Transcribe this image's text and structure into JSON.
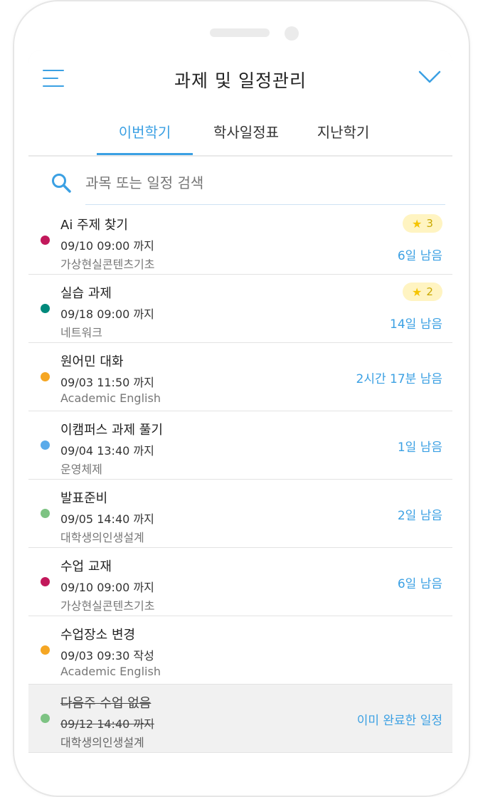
{
  "header": {
    "title": "과제 및 일정관리"
  },
  "tabs": [
    {
      "label": "이번학기"
    },
    {
      "label": "학사일정표"
    },
    {
      "label": "지난학기"
    }
  ],
  "search": {
    "placeholder": "과목 또는 일정 검색"
  },
  "items": [
    {
      "title": "Ai 주제 찾기",
      "due": "09/10 09:00 까지",
      "course": "가상현실콘텐츠기초",
      "color": "#c2185b",
      "stars": "3",
      "remaining": "6일 남음"
    },
    {
      "title": "실습 과제",
      "due": "09/18 09:00 까지",
      "course": "네트워크",
      "color": "#00897b",
      "stars": "2",
      "remaining": "14일 남음"
    },
    {
      "title": "원어민 대화",
      "due": "09/03 11:50 까지",
      "course": "Academic English",
      "color": "#f5a623",
      "stars": null,
      "remaining": "2시간 17분 남음"
    },
    {
      "title": "이캠퍼스 과제 풀기",
      "due": "09/04 13:40 까지",
      "course": "운영체제",
      "color": "#5aabea",
      "stars": null,
      "remaining": "1일 남음"
    },
    {
      "title": "발표준비",
      "due": "09/05 14:40 까지",
      "course": "대학생의인생설계",
      "color": "#7dc383",
      "stars": null,
      "remaining": "2일 남음"
    },
    {
      "title": "수업 교재",
      "due": "09/10 09:00 까지",
      "course": "가상현실콘텐츠기초",
      "color": "#c2185b",
      "stars": null,
      "remaining": "6일 남음"
    },
    {
      "title": "수업장소 변경",
      "due": "09/03 09:30 작성",
      "course": "Academic English",
      "color": "#f5a623",
      "stars": null,
      "remaining": null
    },
    {
      "title": "다음주 수업 없음",
      "due": "09/12 14:40 까지",
      "course": "대학생의인생설계",
      "color": "#7dc383",
      "stars": null,
      "remaining": "이미 완료한 일정",
      "done": true
    }
  ]
}
